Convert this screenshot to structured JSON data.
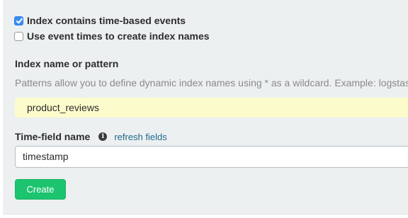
{
  "options": {
    "time_based": {
      "label": "Index contains time-based events",
      "checked": true
    },
    "event_times": {
      "label": "Use event times to create index names",
      "checked": false
    }
  },
  "index_pattern": {
    "label": "Index name or pattern",
    "help": "Patterns allow you to define dynamic index names using * as a wildcard. Example: logstash-*",
    "value": "product_reviews"
  },
  "time_field": {
    "label": "Time-field name",
    "info_icon": "info-icon",
    "refresh_label": "refresh fields",
    "value": "timestamp"
  },
  "actions": {
    "create_label": "Create"
  },
  "colors": {
    "panel_bg": "#ecf0f1",
    "highlight_bg": "#fcfbcb",
    "checkbox_accent": "#3b8cf3",
    "link": "#1f6a8c",
    "create_button": "#1dc46f"
  }
}
